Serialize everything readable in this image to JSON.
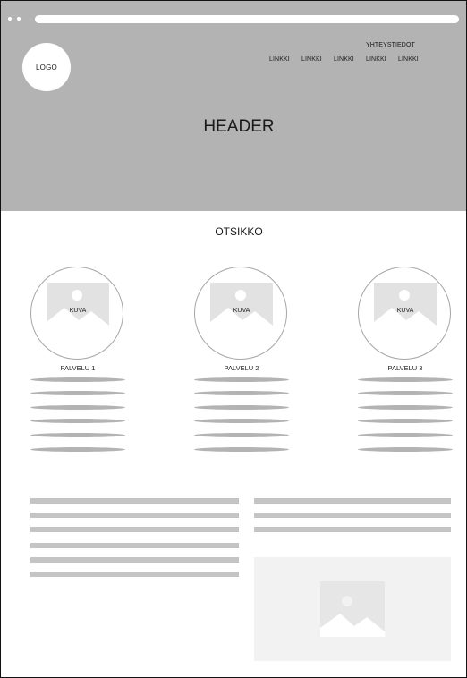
{
  "header": {
    "logo_text": "LOGO",
    "title": "HEADER",
    "contact_link": "YHTEYSTIEDOT",
    "nav_links": [
      "LINKKI",
      "LINKKI",
      "LINKKI",
      "LINKKI",
      "LINKKI"
    ]
  },
  "section": {
    "title": "OTSIKKO"
  },
  "services": [
    {
      "image_label": "KUVA",
      "title": "PALVELU 1"
    },
    {
      "image_label": "KUVA",
      "title": "PALVELU 2"
    },
    {
      "image_label": "KUVA",
      "title": "PALVELU 3"
    }
  ],
  "icons": {
    "image_placeholder": "image-icon"
  },
  "colors": {
    "header_background": "#b3b3b3",
    "placeholder_line": "#c4c4c4",
    "image_placeholder": "#e2e2e2"
  }
}
